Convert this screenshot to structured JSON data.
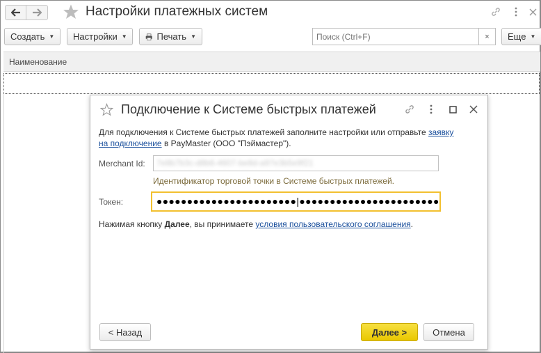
{
  "window": {
    "title": "Настройки платежных систем",
    "icons": {
      "back": "arrow-left-icon",
      "forward": "arrow-right-icon",
      "favorite": "star-icon",
      "link": "link-icon",
      "more": "kebab-icon",
      "close": "close-icon"
    }
  },
  "toolbar": {
    "create_label": "Создать",
    "settings_label": "Настройки",
    "print_label": "Печать",
    "search_placeholder": "Поиск (Ctrl+F)",
    "search_clear": "×",
    "more_label": "Еще"
  },
  "list": {
    "column_header": "Наименование"
  },
  "dialog": {
    "title": "Подключение к Системе быстрых платежей",
    "info_text_1": "Для подключения к Системе быстрых платежей заполните настройки  или отправьте ",
    "info_link": "заявку на подключение",
    "info_text_2": " в PayMaster (ООО \"Пэймастер\").",
    "merchant_label": "Merchant Id:",
    "merchant_value": "7e8b7b3c-d8b6-4607-be8d-a97e3b5e9f21",
    "merchant_hint": "Идентификатор торговой точки в Системе быстрых платежей.",
    "token_label": "Токен:",
    "token_value": "●●●●●●●●●●●●●●●●●●●●●●●|●●●●●●●●●●●●●●●●●●●●●●●●●",
    "note_prefix": "Нажимая кнопку ",
    "note_bold": "Далее",
    "note_middle": ", вы принимаете ",
    "note_link": "условия пользовательского соглашения",
    "note_suffix": ".",
    "back_button": "< Назад",
    "next_button": "Далее >",
    "cancel_button": "Отмена"
  },
  "colors": {
    "accent_yellow": "#f2c02f",
    "link_blue": "#1a4f9c",
    "hint_text": "#7b6a3a"
  }
}
